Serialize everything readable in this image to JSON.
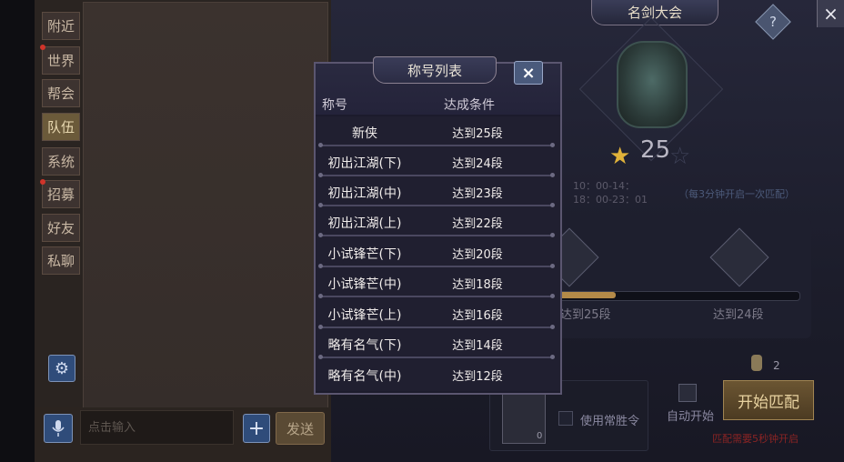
{
  "chat": {
    "channels": [
      {
        "label": "附近",
        "active": false,
        "badge": false
      },
      {
        "label": "世界",
        "active": false,
        "badge": true
      },
      {
        "label": "帮会",
        "active": false,
        "badge": false
      },
      {
        "label": "队伍",
        "active": true,
        "badge": false
      },
      {
        "label": "系统",
        "active": false,
        "badge": false
      },
      {
        "label": "招募",
        "active": false,
        "badge": true
      },
      {
        "label": "好友",
        "active": false,
        "badge": false
      },
      {
        "label": "私聊",
        "active": false,
        "badge": false
      }
    ],
    "input_placeholder": "点击输入",
    "send_label": "发送",
    "plus_label": "+"
  },
  "event": {
    "title": "名剑大会",
    "close_label": "×",
    "help_label": "?",
    "rank_value": "25",
    "time_lines": [
      "10：00-14：",
      "18：00-23：01"
    ],
    "match_note": "（每3分钟开启一次匹配）",
    "rewards": [
      {
        "label": "达到25段"
      },
      {
        "label": "达到24段"
      }
    ],
    "progress": 0.25,
    "coin_count": "2",
    "item_qty": "0",
    "use_item_label": "使用常胜令",
    "auto_start_label": "自动开始",
    "start_button": "开始匹配",
    "warning_text": "匹配需要5秒钟开启"
  },
  "dialog": {
    "title": "称号列表",
    "close_label": "×",
    "columns": [
      "称号",
      "达成条件"
    ],
    "rows": [
      {
        "name": "新侠",
        "condition": "达到25段"
      },
      {
        "name": "初出江湖(下)",
        "condition": "达到24段"
      },
      {
        "name": "初出江湖(中)",
        "condition": "达到23段"
      },
      {
        "name": "初出江湖(上)",
        "condition": "达到22段"
      },
      {
        "name": "小试锋芒(下)",
        "condition": "达到20段"
      },
      {
        "name": "小试锋芒(中)",
        "condition": "达到18段"
      },
      {
        "name": "小试锋芒(上)",
        "condition": "达到16段"
      },
      {
        "name": "略有名气(下)",
        "condition": "达到14段"
      },
      {
        "name": "略有名气(中)",
        "condition": "达到12段"
      }
    ]
  },
  "colors": {
    "accent_gold": "#e0b23a",
    "active_channel": "#6b5a3a",
    "warning_red": "#8a2424"
  }
}
